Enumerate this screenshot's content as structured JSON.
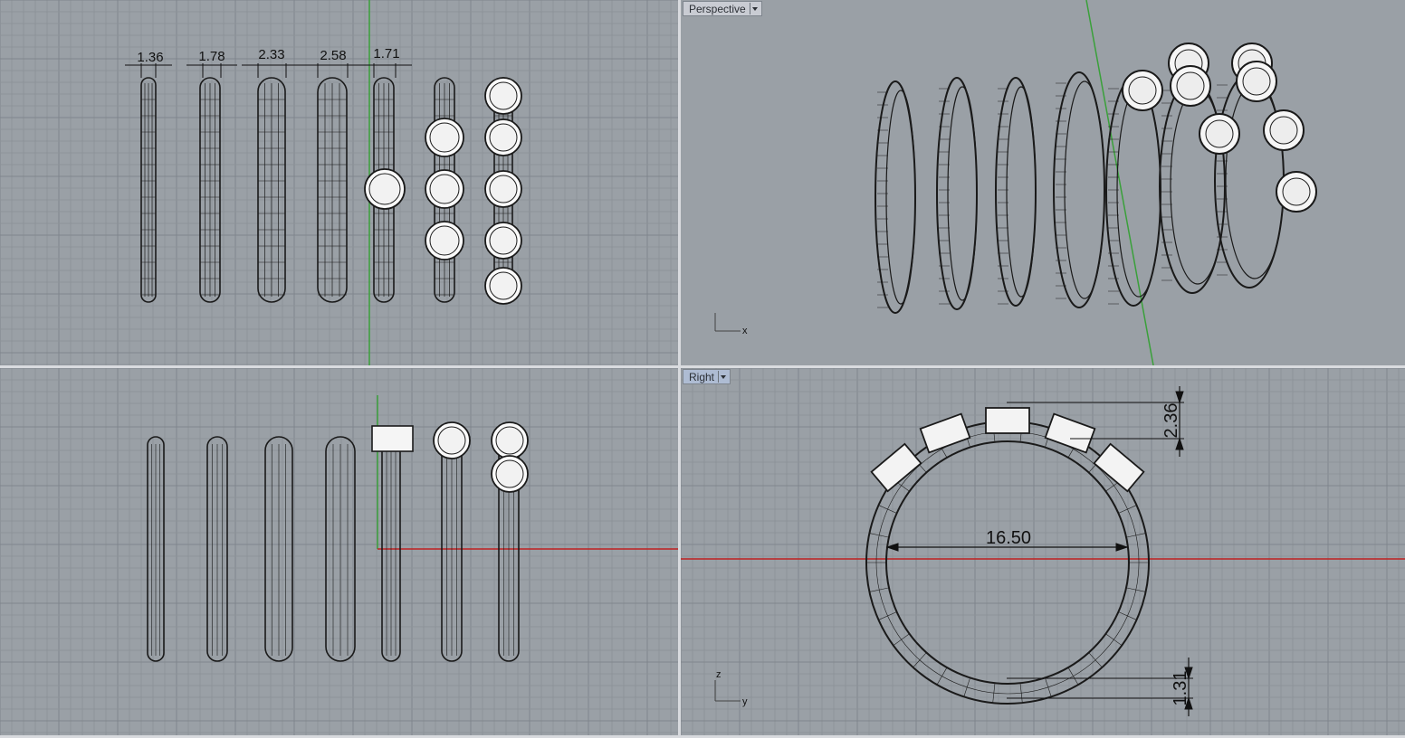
{
  "viewports": {
    "top": {
      "label": "",
      "dims": [
        "1.36",
        "1.78",
        "2.33",
        "2.58",
        "1.71"
      ]
    },
    "perspective": {
      "label": "Perspective",
      "axis_x": "x"
    },
    "front": {
      "label": ""
    },
    "right": {
      "label": "Right",
      "dim_width": "16.50",
      "dim_head": "2.36",
      "dim_band": "1.31",
      "axis_z": "z",
      "axis_y": "y"
    }
  },
  "colors": {
    "viewport_bg": "#9aa0a6",
    "grid_minor": "#8c9298",
    "grid_major": "#7d838a",
    "axis_green": "#3aa03a",
    "axis_red": "#c02020",
    "wire": "#1a1a1a"
  }
}
